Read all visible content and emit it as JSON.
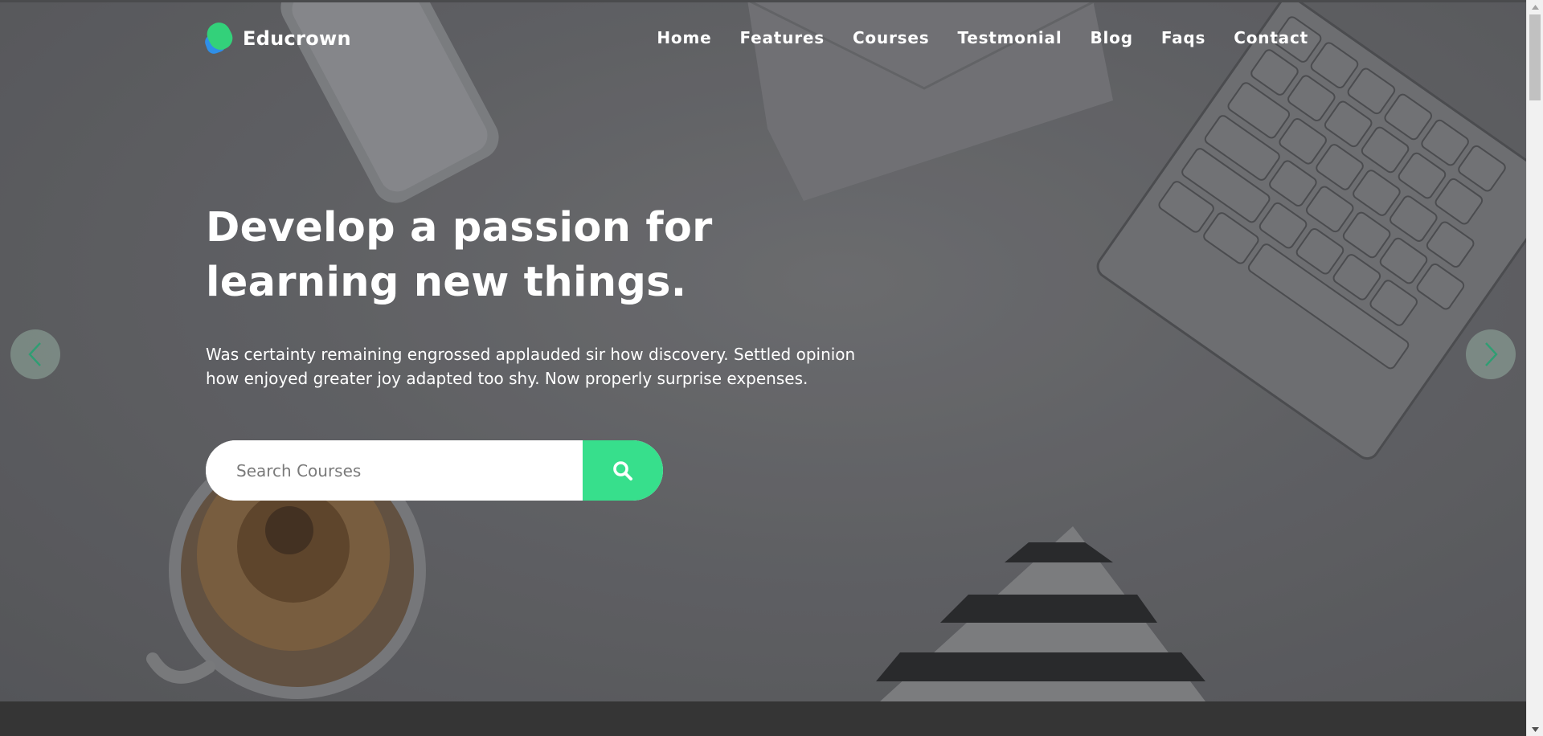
{
  "brand": {
    "name": "Educrown",
    "colors": {
      "green": "#33d17a",
      "blue": "#2f8fe8"
    }
  },
  "nav": {
    "items": [
      "Home",
      "Features",
      "Courses",
      "Testmonial",
      "Blog",
      "Faqs",
      "Contact"
    ]
  },
  "hero": {
    "title_line1": "Develop a passion for",
    "title_line2": "learning new things.",
    "description_line1": "Was certainty remaining engrossed applauded sir how discovery. Settled opinion",
    "description_line2": "how enjoyed greater joy adapted too shy. Now properly surprise expenses."
  },
  "search": {
    "placeholder": "Search Courses",
    "value": "",
    "button_icon": "search-icon",
    "button_color": "#37df8c"
  },
  "carousel": {
    "prev_icon": "chevron-left-icon",
    "next_icon": "chevron-right-icon"
  }
}
